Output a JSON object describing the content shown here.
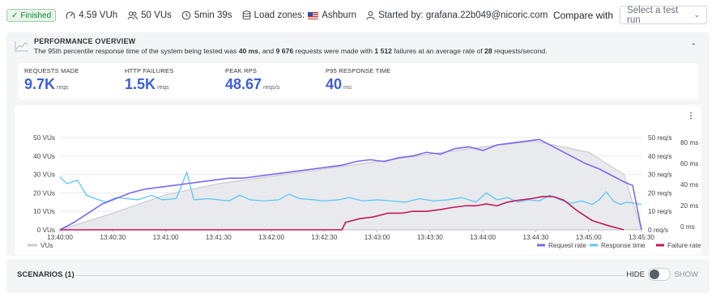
{
  "topbar": {
    "status": "Finished",
    "vuh": "4.59 VUh",
    "vus": "50 VUs",
    "duration": "5min 39s",
    "load_zones_label": "Load zones:",
    "load_zone": "Ashburn",
    "started_by": "Started by: grafana.22b049@nicoric.com",
    "compare_label": "Compare with",
    "compare_placeholder": "Select a test run"
  },
  "overview": {
    "title": "PERFORMANCE OVERVIEW",
    "summary_pre": "The 95th percentile response time of the system being tested was ",
    "summary_rt": "40 ms",
    "summary_mid": ", and ",
    "summary_reqs": "9 676",
    "summary_mid2": " requests were made with ",
    "summary_fail": "1 512",
    "summary_mid3": " failures at an average rate of ",
    "summary_rate": "28",
    "summary_post": " requests/second."
  },
  "stats": [
    {
      "label": "REQUESTS MADE",
      "value": "9.7K",
      "unit": "reqs"
    },
    {
      "label": "HTTP FAILURES",
      "value": "1.5K",
      "unit": "reqs"
    },
    {
      "label": "PEAK RPS",
      "value": "48.67",
      "unit": "reqs/s"
    },
    {
      "label": "P95 RESPONSE TIME",
      "value": "40",
      "unit": "ms"
    }
  ],
  "colors": {
    "accent": "#3d5fd9",
    "vus": "#c9ccd1",
    "request_rate": "#7b68ee",
    "response_time": "#5ac8fa",
    "failure_rate": "#c2185b"
  },
  "chart_data": {
    "type": "line",
    "x": [
      "13:40:00",
      "13:40:30",
      "13:41:00",
      "13:41:30",
      "13:42:00",
      "13:42:30",
      "13:43:00",
      "13:43:30",
      "13:44:00",
      "13:44:30",
      "13:45:00",
      "13:45:30"
    ],
    "left_ticks": [
      "0 VUs",
      "10 VUs",
      "20 VUs",
      "30 VUs",
      "40 VUs",
      "50 VUs"
    ],
    "right_ticks_rps": [
      "0 req/s",
      "10 req/s",
      "20 req/s",
      "30 req/s",
      "40 req/s",
      "50 req/s"
    ],
    "right_ticks_ms": [
      "0 ms",
      "20 ms",
      "40 ms",
      "60 ms",
      "80 ms"
    ],
    "series": [
      {
        "name": "VUs",
        "axis": "vus",
        "values": [
          0,
          9,
          19,
          25,
          29,
          33,
          37,
          41,
          45,
          48,
          42,
          30,
          0
        ],
        "t": [
          0,
          30,
          60,
          90,
          120,
          150,
          180,
          210,
          240,
          270,
          300,
          320,
          330
        ]
      },
      {
        "name": "Request rate",
        "axis": "rps",
        "values": [
          0,
          4,
          9,
          14,
          17,
          20,
          22,
          23,
          24,
          25,
          26,
          27,
          28,
          28,
          29,
          30,
          31,
          32,
          33,
          34,
          35,
          37,
          38,
          37,
          39,
          40,
          42,
          41,
          44,
          45,
          43,
          46,
          47,
          48,
          49,
          47,
          44,
          40,
          36,
          33,
          29,
          26,
          24,
          0
        ],
        "t": [
          0,
          8,
          16,
          24,
          32,
          40,
          48,
          56,
          64,
          72,
          80,
          88,
          96,
          104,
          112,
          120,
          128,
          136,
          144,
          152,
          160,
          168,
          176,
          184,
          192,
          200,
          208,
          216,
          224,
          232,
          240,
          248,
          256,
          264,
          272,
          276,
          282,
          290,
          298,
          306,
          314,
          320,
          325,
          330
        ]
      },
      {
        "name": "Response time",
        "axis": "ms",
        "values": [
          46,
          40,
          43,
          30,
          27,
          24,
          28,
          27,
          26,
          30,
          26,
          27,
          50,
          26,
          27,
          26,
          25,
          30,
          26,
          25,
          26,
          31,
          27,
          26,
          25,
          26,
          28,
          25,
          26,
          25,
          24,
          27,
          25,
          26,
          28,
          24,
          32,
          26,
          28,
          24,
          26,
          25,
          30,
          26,
          23,
          25,
          22,
          26,
          33,
          25,
          22,
          24,
          23,
          22
        ],
        "t": [
          0,
          4,
          10,
          15,
          20,
          26,
          32,
          38,
          44,
          52,
          58,
          66,
          72,
          76,
          84,
          90,
          96,
          102,
          108,
          116,
          124,
          130,
          136,
          144,
          150,
          158,
          164,
          172,
          180,
          188,
          196,
          204,
          212,
          220,
          228,
          236,
          242,
          248,
          254,
          260,
          266,
          272,
          278,
          284,
          290,
          296,
          302,
          306,
          310,
          314,
          318,
          322,
          326,
          330
        ]
      },
      {
        "name": "Failure rate",
        "axis": "rps",
        "values": [
          0,
          0,
          0,
          0,
          0,
          4,
          6,
          7,
          9,
          9,
          10,
          10,
          11,
          12,
          13,
          13,
          14,
          13,
          15,
          16,
          17,
          18,
          18,
          16,
          10,
          5,
          2,
          0
        ],
        "t": [
          0,
          50,
          100,
          150,
          160,
          162,
          170,
          178,
          186,
          194,
          200,
          208,
          216,
          222,
          230,
          236,
          242,
          248,
          254,
          260,
          268,
          274,
          280,
          286,
          294,
          302,
          312,
          320
        ]
      }
    ],
    "legend": [
      "Request rate",
      "Response time",
      "Failure rate"
    ],
    "legend_left": "VUs",
    "ylim_vus": [
      0,
      50
    ],
    "ylim_rps": [
      0,
      50
    ],
    "ylim_ms": [
      0,
      80
    ],
    "grid": true
  },
  "scenarios": {
    "title": "SCENARIOS (1)",
    "hide": "HIDE",
    "show": "SHOW"
  }
}
